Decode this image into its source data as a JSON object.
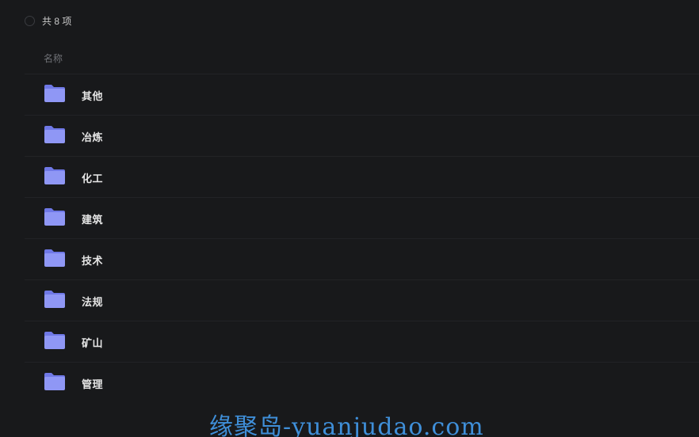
{
  "header": {
    "count_text": "共 8 项"
  },
  "columns": {
    "name_label": "名称"
  },
  "folders": [
    {
      "label": "其他"
    },
    {
      "label": "冶炼"
    },
    {
      "label": "化工"
    },
    {
      "label": "建筑"
    },
    {
      "label": "技术"
    },
    {
      "label": "法规"
    },
    {
      "label": "矿山"
    },
    {
      "label": "管理"
    }
  ],
  "watermark": {
    "text": "缘聚岛-yuanjudao.com"
  },
  "colors": {
    "background": "#18191b",
    "folder_front": "#8f97f5",
    "folder_back": "#6f78e6",
    "watermark": "#3f8fd9"
  }
}
